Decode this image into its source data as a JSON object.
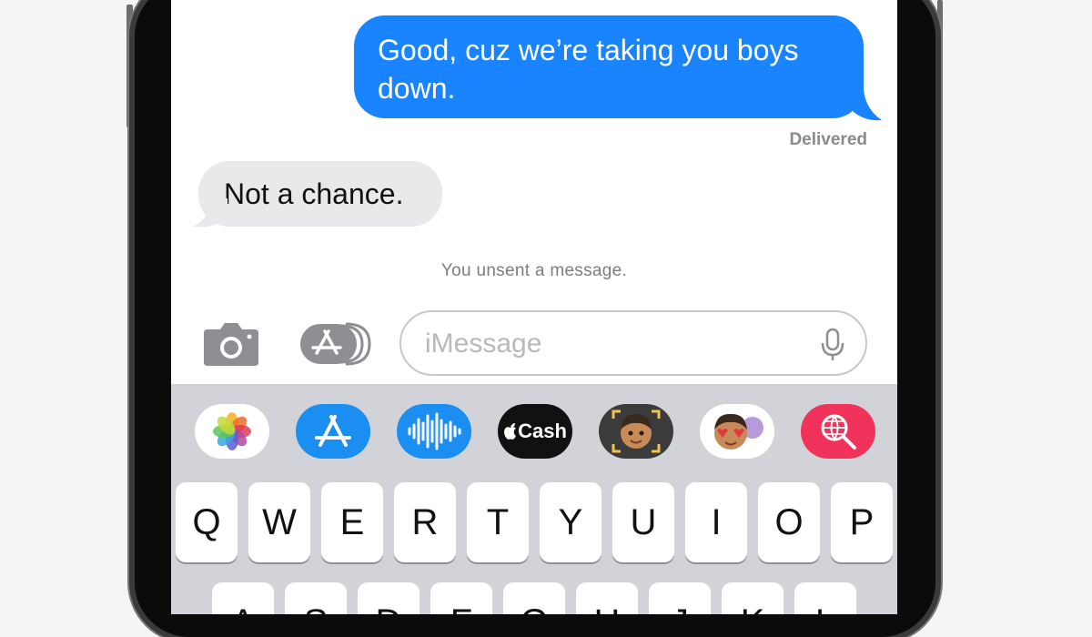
{
  "messages": {
    "outgoing_text": "Good, cuz we’re taking you boys down.",
    "status": "Delivered",
    "incoming_text": "Not a chance.",
    "system_notice": "You unsent a message."
  },
  "input": {
    "placeholder": "iMessage"
  },
  "app_strip": [
    {
      "name": "photos-app-icon"
    },
    {
      "name": "app-store-icon"
    },
    {
      "name": "audio-message-icon"
    },
    {
      "name": "apple-cash-icon",
      "label": "Cash"
    },
    {
      "name": "memoji-icon"
    },
    {
      "name": "memoji-stickers-icon"
    },
    {
      "name": "image-search-icon"
    }
  ],
  "keyboard": {
    "row1": [
      "Q",
      "W",
      "E",
      "R",
      "T",
      "Y",
      "U",
      "I",
      "O",
      "P"
    ],
    "row2": [
      "A",
      "S",
      "D",
      "F",
      "G",
      "H",
      "J",
      "K",
      "L"
    ]
  },
  "colors": {
    "outgoing_bubble": "#1a84fe",
    "incoming_bubble": "#e9e9eb",
    "keyboard_bg": "#d1d3d9"
  }
}
